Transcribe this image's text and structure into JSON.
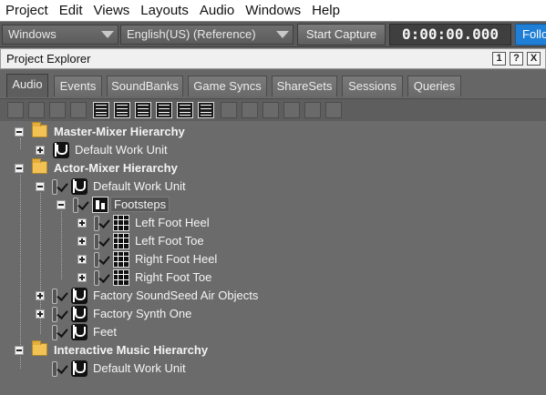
{
  "menubar": {
    "items": [
      "Project",
      "Edit",
      "Views",
      "Layouts",
      "Audio",
      "Windows",
      "Help"
    ]
  },
  "toolbar": {
    "layout_combo": "Windows",
    "language_combo": "English(US) (Reference)",
    "capture_button": "Start Capture",
    "timecode": "0:00:00.000",
    "follow_button": "Follo"
  },
  "panel": {
    "title": "Project Explorer",
    "buttons": [
      "1",
      "?",
      "X"
    ]
  },
  "tabs": [
    "Audio",
    "Events",
    "SoundBanks",
    "Game Syncs",
    "ShareSets",
    "Sessions",
    "Queries"
  ],
  "active_tab": "Audio",
  "tree": {
    "master_mixer": "Master-Mixer Hierarchy",
    "master_default_work_unit": "Default Work Unit",
    "actor_mixer": "Actor-Mixer Hierarchy",
    "actor_default_work_unit": "Default Work Unit",
    "footsteps": "Footsteps",
    "left_foot_heel": "Left Foot Heel",
    "left_foot_toe": "Left Foot Toe",
    "right_foot_heel": "Right Foot Heel",
    "right_foot_toe": "Right Foot Toe",
    "factory_soundseed": "Factory SoundSeed Air Objects",
    "factory_synth": "Factory Synth One",
    "feet": "Feet",
    "interactive_music": "Interactive Music Hierarchy",
    "interactive_default_work_unit": "Default Work Unit"
  },
  "colors": {
    "background": "#6b6b6b",
    "menubar": "#ffffff",
    "follow_accent": "#1f7fd6",
    "folder": "#f2c255"
  }
}
